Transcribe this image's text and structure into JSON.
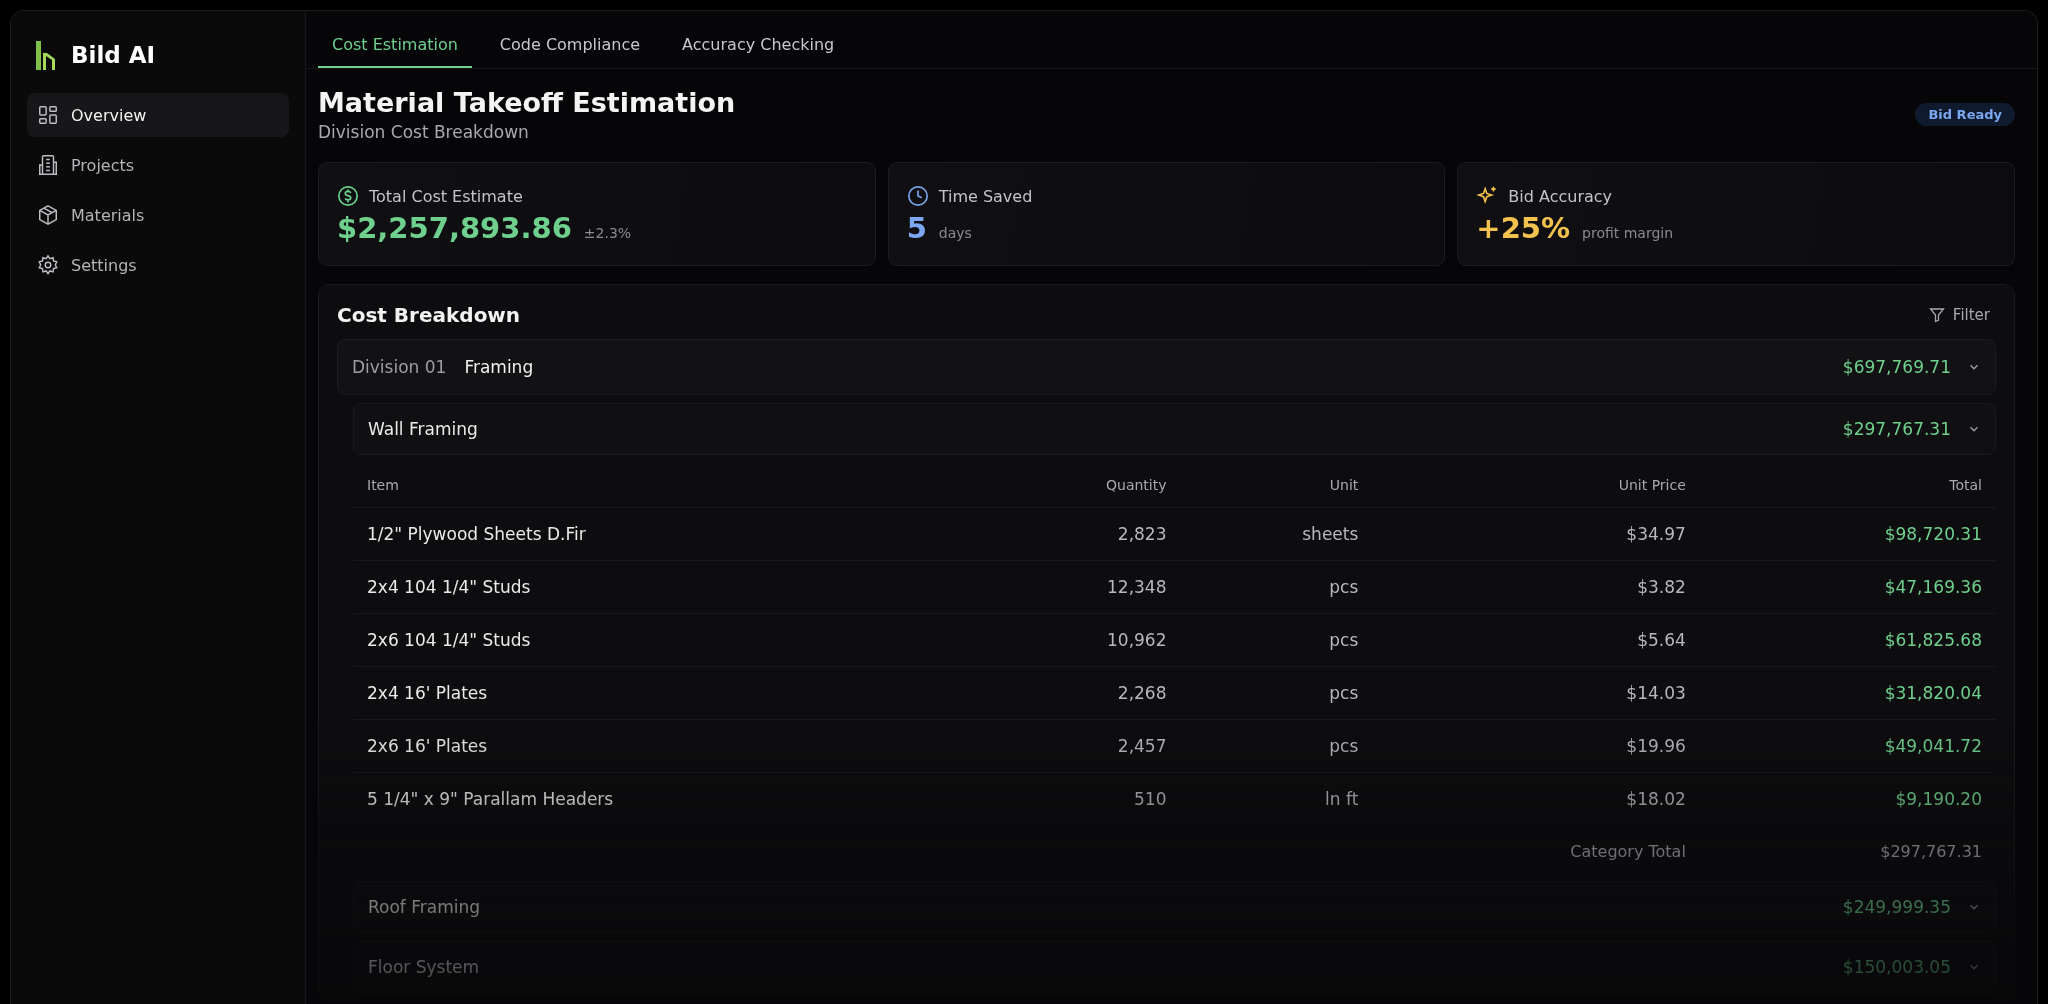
{
  "brand": {
    "name": "Bild AI"
  },
  "sidebar": {
    "items": [
      {
        "label": "Overview",
        "kind": "grid",
        "selected": true
      },
      {
        "label": "Projects",
        "kind": "building",
        "selected": false
      },
      {
        "label": "Materials",
        "kind": "box",
        "selected": false
      },
      {
        "label": "Settings",
        "kind": "gear",
        "selected": false
      }
    ]
  },
  "tabs": [
    {
      "label": "Cost Estimation",
      "selected": true
    },
    {
      "label": "Code Compliance",
      "selected": false
    },
    {
      "label": "Accuracy Checking",
      "selected": false
    }
  ],
  "header": {
    "title": "Material Takeoff Estimation",
    "subtitle": "Division Cost Breakdown",
    "badge": "Bid Ready"
  },
  "stats": [
    {
      "kind": "dollar",
      "label": "Total Cost Estimate",
      "value": "$2,257,893.86",
      "note": "±2.3%",
      "color": "#6fd08e"
    },
    {
      "kind": "clock",
      "label": "Time Saved",
      "value": "5",
      "note": "days",
      "color": "#7aa7f0"
    },
    {
      "kind": "sparkle",
      "label": "Bid Accuracy",
      "value": "+25%",
      "note": "profit margin",
      "color": "#f2c14e"
    }
  ],
  "breakdown": {
    "title": "Cost Breakdown",
    "filter": "Filter",
    "division": {
      "code": "Division 01",
      "name": "Framing",
      "total": "$697,769.71",
      "expanded": true
    },
    "categories": [
      {
        "name": "Wall Framing",
        "total": "$297,767.31",
        "expanded": true,
        "columns": [
          "Item",
          "Quantity",
          "Unit",
          "Unit Price",
          "Total"
        ],
        "rows": [
          [
            "1/2\" Plywood Sheets D.Fir",
            "2,823",
            "sheets",
            "$34.97",
            "$98,720.31"
          ],
          [
            "2x4 104 1/4\" Studs",
            "12,348",
            "pcs",
            "$3.82",
            "$47,169.36"
          ],
          [
            "2x6 104 1/4\" Studs",
            "10,962",
            "pcs",
            "$5.64",
            "$61,825.68"
          ],
          [
            "2x4 16' Plates",
            "2,268",
            "pcs",
            "$14.03",
            "$31,820.04"
          ],
          [
            "2x6 16' Plates",
            "2,457",
            "pcs",
            "$19.96",
            "$49,041.72"
          ],
          [
            "5 1/4\" x 9\" Parallam Headers",
            "510",
            "ln ft",
            "$18.02",
            "$9,190.20"
          ]
        ],
        "total_label": "Category Total",
        "total_value": "$297,767.31"
      },
      {
        "name": "Roof Framing",
        "total": "$249,999.35",
        "expanded": false
      },
      {
        "name": "Floor System",
        "total": "$150,003.05",
        "expanded": false
      }
    ]
  }
}
